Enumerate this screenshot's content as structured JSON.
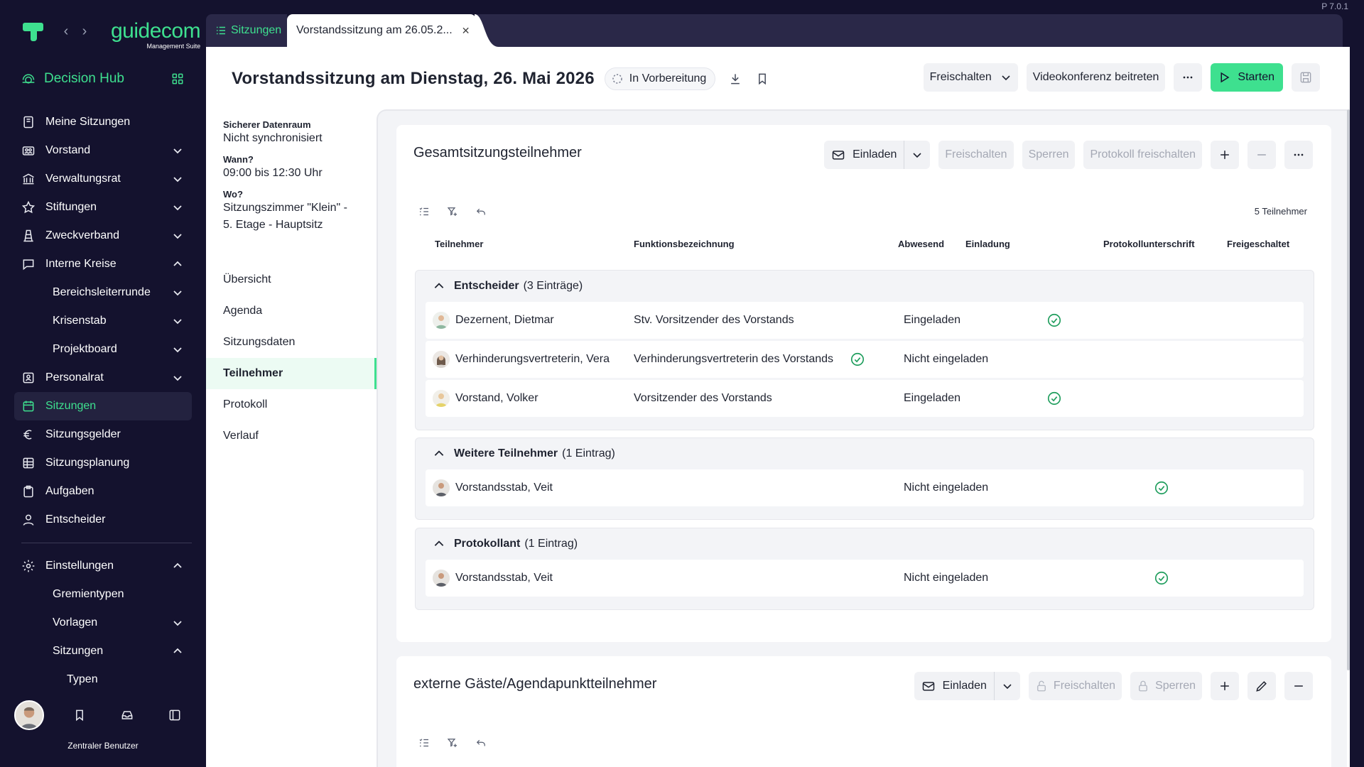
{
  "app": {
    "version": "P 7.0.1",
    "brand_name": "guidecom",
    "brand_sub": "Management Suite",
    "hub_label": "Decision Hub",
    "colors": {
      "accent": "#3ee08f",
      "sidebar_bg": "#14122e",
      "check": "#1e9d5c"
    }
  },
  "sidebar": {
    "items": [
      {
        "label": "Meine Sitzungen",
        "icon": "notebook-icon"
      },
      {
        "label": "Vorstand",
        "icon": "users-icon",
        "chevron": "down"
      },
      {
        "label": "Verwaltungsrat",
        "icon": "bank-icon",
        "chevron": "down"
      },
      {
        "label": "Stiftungen",
        "icon": "star-icon",
        "chevron": "down"
      },
      {
        "label": "Zweckverband",
        "icon": "tower-icon",
        "chevron": "down"
      },
      {
        "label": "Interne Kreise",
        "icon": "chat-icon",
        "chevron": "up"
      },
      {
        "label": "Bereichsleiterrunde",
        "chevron": "down",
        "level": 1
      },
      {
        "label": "Krisenstab",
        "chevron": "down",
        "level": 1
      },
      {
        "label": "Projektboard",
        "chevron": "down",
        "level": 1
      },
      {
        "label": "Personalrat",
        "icon": "id-card-icon",
        "chevron": "down"
      },
      {
        "label": "Sitzungen",
        "icon": "calendar-icon",
        "active": true
      },
      {
        "label": "Sitzungsgelder",
        "icon": "euro-icon"
      },
      {
        "label": "Sitzungsplanung",
        "icon": "table-icon"
      },
      {
        "label": "Aufgaben",
        "icon": "clipboard-icon"
      },
      {
        "label": "Entscheider",
        "icon": "user-icon"
      }
    ],
    "settings": [
      {
        "label": "Einstellungen",
        "icon": "gear-icon",
        "chevron": "up"
      },
      {
        "label": "Gremientypen",
        "level": 1
      },
      {
        "label": "Vorlagen",
        "chevron": "down",
        "level": 1
      },
      {
        "label": "Sitzungen",
        "chevron": "up",
        "level": 1
      },
      {
        "label": "Typen",
        "level": 2
      }
    ],
    "user_name": "Zentraler Benutzer"
  },
  "tabs": {
    "list_label": "Sitzungen",
    "active_label": "Vorstandssitzung am 26.05.2..."
  },
  "header": {
    "title": "Vorstandssitzung am Dienstag, 26. Mai 2026",
    "status": "In Vorbereitung",
    "btn_freischalten": "Freischalten",
    "btn_video": "Videokonferenz beitreten",
    "btn_start": "Starten"
  },
  "meta": {
    "room_label": "Sicherer Datenraum",
    "room_value": "Nicht synchronisiert",
    "when_label": "Wann?",
    "when_value": "09:00 bis 12:30 Uhr",
    "where_label": "Wo?",
    "where_line1": "Sitzungszimmer \"Klein\" -",
    "where_line2": "5. Etage - Hauptsitz"
  },
  "subnav": [
    "Übersicht",
    "Agenda",
    "Sitzungsdaten",
    "Teilnehmer",
    "Protokoll",
    "Verlauf"
  ],
  "card1": {
    "title": "Gesamtsitzungsteilnehmer",
    "btn_invite": "Einladen",
    "btn_unlock": "Freischalten",
    "btn_lock": "Sperren",
    "btn_protocol": "Protokoll freischalten",
    "count": "5 Teilnehmer",
    "columns": [
      "Teilnehmer",
      "Funktionsbezeichnung",
      "Abwesend",
      "Einladung",
      "Protokollunterschrift",
      "Freigeschaltet"
    ],
    "groups": [
      {
        "name": "Entscheider",
        "count": "(3 Einträge)",
        "rows": [
          {
            "name": "Dezernent, Dietmar",
            "function": "Stv. Vorsitzender des Vorstands",
            "absent": false,
            "invitation": "Eingeladen",
            "signature": true,
            "unlocked": false
          },
          {
            "name": "Verhinderungsvertreterin, Vera",
            "function": "Verhinderungsvertreterin des Vorstands",
            "absent": true,
            "invitation": "Nicht eingeladen",
            "signature": false,
            "unlocked": false
          },
          {
            "name": "Vorstand, Volker",
            "function": "Vorsitzender des Vorstands",
            "absent": false,
            "invitation": "Eingeladen",
            "signature": true,
            "unlocked": false
          }
        ]
      },
      {
        "name": "Weitere Teilnehmer",
        "count": "(1 Eintrag)",
        "rows": [
          {
            "name": "Vorstandsstab, Veit",
            "function": "",
            "absent": false,
            "invitation": "Nicht eingeladen",
            "signature": false,
            "unlocked": true
          }
        ]
      },
      {
        "name": "Protokollant",
        "count": "(1 Eintrag)",
        "rows": [
          {
            "name": "Vorstandsstab, Veit",
            "function": "",
            "absent": false,
            "invitation": "Nicht eingeladen",
            "signature": false,
            "unlocked": true
          }
        ]
      }
    ]
  },
  "card2": {
    "title": "externe Gäste/Agendapunktteilnehmer",
    "btn_invite": "Einladen",
    "btn_unlock": "Freischalten",
    "btn_lock": "Sperren"
  }
}
